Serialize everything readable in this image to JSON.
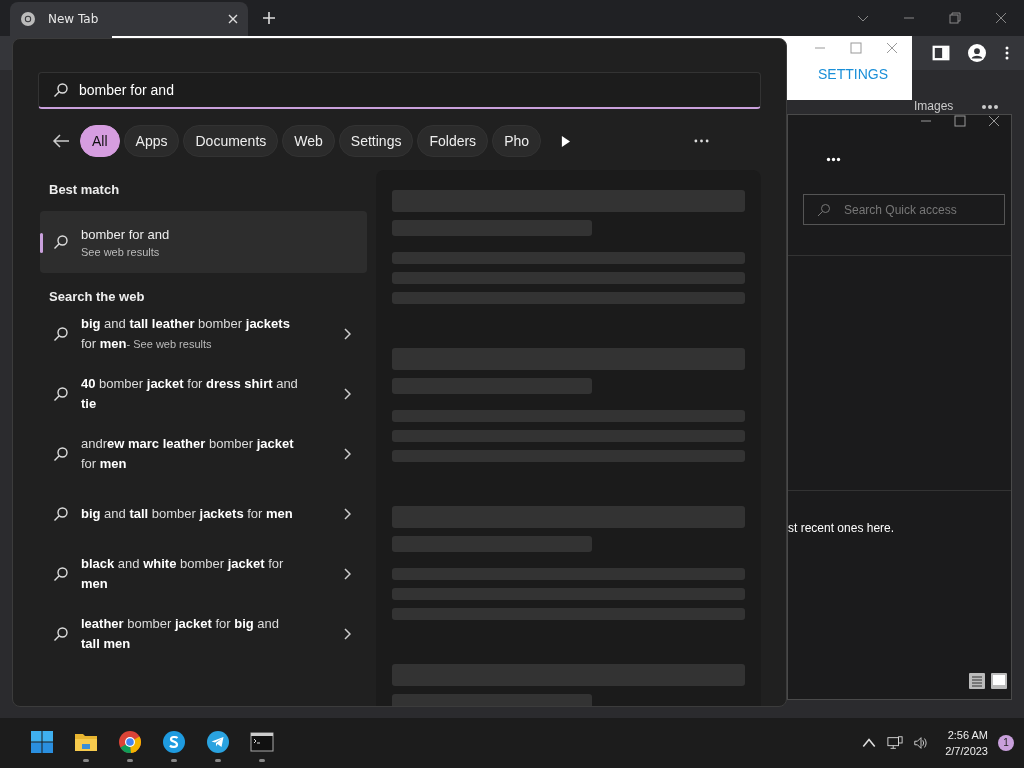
{
  "browser": {
    "tab": {
      "title": "New Tab",
      "selected": true
    },
    "behind_label": "Images"
  },
  "popup": {
    "link": "SETTINGS"
  },
  "explorer": {
    "search": {
      "placeholder": "Search Quick access"
    },
    "message": "st recent ones here."
  },
  "start_search": {
    "query": "bomber for and",
    "filters": [
      {
        "label": "All",
        "selected": true
      },
      {
        "label": "Apps",
        "selected": false
      },
      {
        "label": "Documents",
        "selected": false
      },
      {
        "label": "Web",
        "selected": false
      },
      {
        "label": "Settings",
        "selected": false
      },
      {
        "label": "Folders",
        "selected": false
      },
      {
        "label": "Pho",
        "selected": false
      }
    ],
    "best_match": {
      "heading": "Best match",
      "title": "bomber for and",
      "subtitle": "See web results",
      "selected": true
    },
    "web": {
      "heading": "Search the web",
      "items": [
        {
          "text": "**big** and **tall leather** bomber **jackets** for **men**",
          "hint": "- See web results"
        },
        {
          "text": "**40** bomber **jacket** for **dress shirt** and **tie**"
        },
        {
          "text": "andr**ew marc leather** bomber **jacket** for **men**"
        },
        {
          "text": "**big** and **tall** bomber **jackets** for **men**"
        },
        {
          "text": "**black** and **white** bomber **jacket** for **men**"
        },
        {
          "text": "**leather** bomber **jacket** for **big** and **tall men**"
        }
      ]
    }
  },
  "taskbar": {
    "apps": [
      {
        "kind": "start",
        "running": false
      },
      {
        "kind": "files",
        "running": true
      },
      {
        "kind": "browser",
        "running": true
      },
      {
        "kind": "skype",
        "running": true
      },
      {
        "kind": "telegram",
        "running": true
      },
      {
        "kind": "terminal",
        "running": true
      }
    ],
    "clock": {
      "time": "2:56 AM",
      "date": "2/7/2023"
    },
    "notifications": "1"
  }
}
